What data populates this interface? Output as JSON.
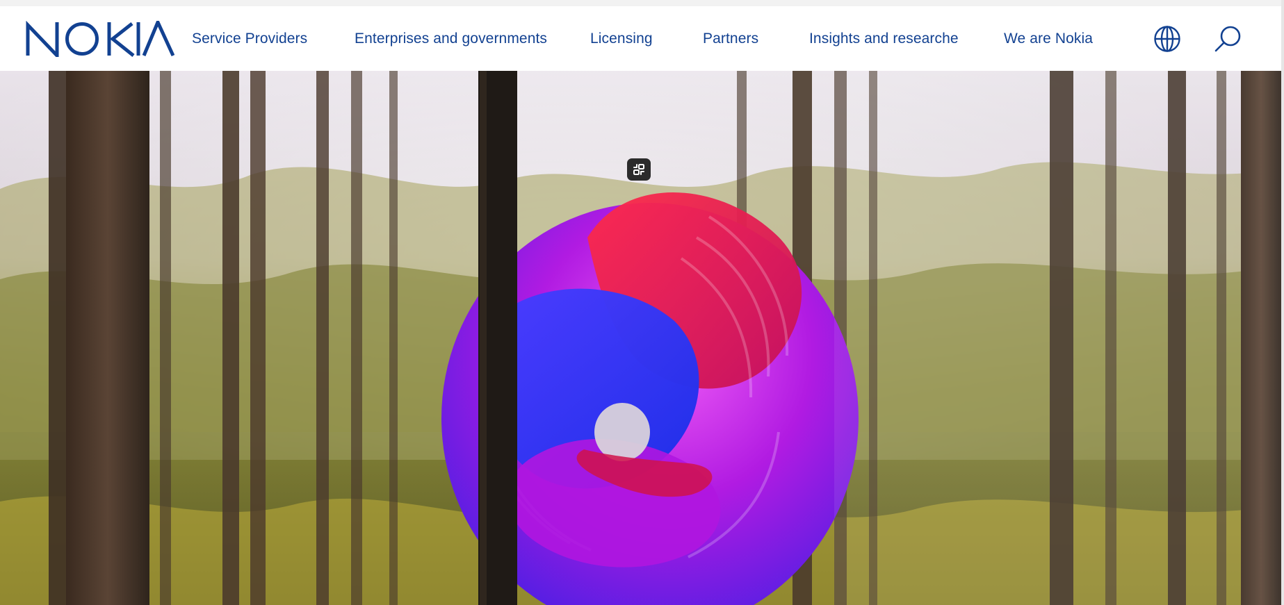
{
  "brand": {
    "logo_text": "NOKIA",
    "color": "#124191"
  },
  "nav": {
    "links": [
      "Service Providers",
      "Enterprises and governments",
      "Licensing",
      "Partners",
      "Insights and researche",
      "We are Nokia"
    ]
  },
  "icons": {
    "language": "globe-icon",
    "search": "search-icon",
    "video_control": "exit-fullscreen-icon"
  },
  "hero": {
    "media": "forest-background-video",
    "subject": "3d-abstract-swirl",
    "palette": [
      "#e0123a",
      "#b21ad8",
      "#3b2cf0",
      "#d7c83a"
    ]
  }
}
